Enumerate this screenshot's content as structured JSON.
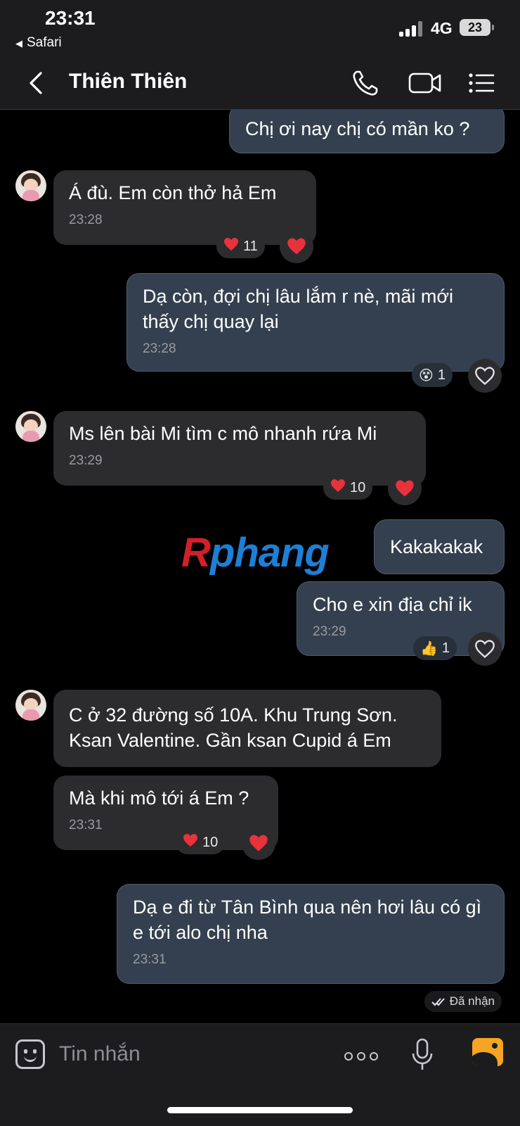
{
  "status_bar": {
    "time": "23:31",
    "back_app": "Safari",
    "network": "4G",
    "battery": "23"
  },
  "header": {
    "title": "Thiên Thiên",
    "icons": [
      "back-icon",
      "phone-icon",
      "video-icon",
      "menu-icon"
    ]
  },
  "messages": [
    {
      "dir": "out",
      "text": "Chị ơi nay chị có mần ko ?"
    },
    {
      "dir": "in",
      "text": "Á đù. Em còn thở hả Em",
      "time": "23:28",
      "reaction": {
        "emoji": "❤",
        "count": "11"
      }
    },
    {
      "dir": "out",
      "text": "Dạ còn, đợi chị lâu lắm r nè, mãi mới thấy chị quay lại",
      "time": "23:28",
      "reaction": {
        "emoji": "😵",
        "count": "1"
      }
    },
    {
      "dir": "in",
      "text": "Ms lên bài Mi tìm c mô nhanh rứa Mi",
      "time": "23:29",
      "reaction": {
        "emoji": "❤",
        "count": "10"
      }
    },
    {
      "dir": "out",
      "text": "Kakakakak"
    },
    {
      "dir": "out",
      "text": "Cho e xin địa chỉ ik",
      "time": "23:29",
      "reaction": {
        "emoji": "👍",
        "count": "1"
      }
    },
    {
      "dir": "in",
      "text": "C ở 32 đường số 10A. Khu Trung Sơn. Ksan Valentine. Gần ksan Cupid á Em"
    },
    {
      "dir": "in",
      "text": "Mà khi mô tới á Em ?",
      "time": "23:31",
      "reaction": {
        "emoji": "❤",
        "count": "10"
      }
    },
    {
      "dir": "out",
      "text": "Dạ e đi từ Tân Bình qua nên hơi lâu có gì e tới alo chị nha",
      "time": "23:31"
    }
  ],
  "seen_status": "Đã nhận",
  "watermark": {
    "part1": "R",
    "part2": "phang"
  },
  "composer": {
    "placeholder": "Tin nhắn"
  },
  "colors": {
    "incoming_bubble": "#2c2c2e",
    "outgoing_bubble": "#34404f",
    "background": "#000000",
    "photo_accent": "#f5a524",
    "heart": "#e8323c"
  }
}
